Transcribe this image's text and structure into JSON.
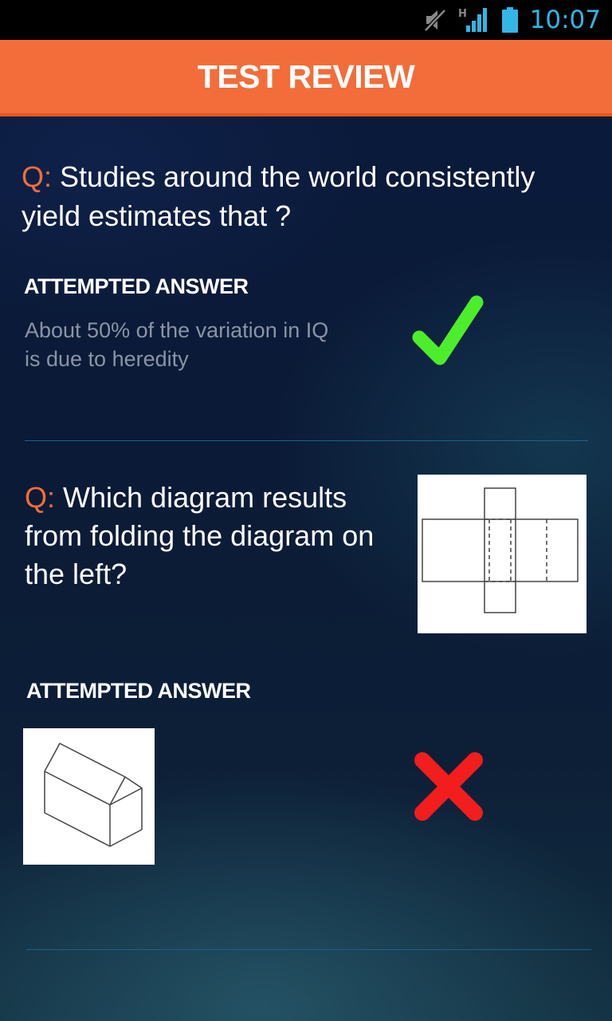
{
  "status_bar": {
    "time": "10:07",
    "network_type": "H",
    "icons": [
      "mute-icon",
      "signal-icon",
      "battery-icon"
    ]
  },
  "app_bar": {
    "title": "TEST REVIEW"
  },
  "questions": [
    {
      "prefix": "Q:",
      "text": "Studies around the world consistently yield estimates that ?",
      "attempted_label": "ATTEMPTED ANSWER",
      "answer_text": "About 50% of the variation in IQ is due to heredity",
      "result": "correct"
    },
    {
      "prefix": "Q:",
      "text": "Which diagram results from folding the diagram on the left?",
      "question_image": "unfolded-net-diagram",
      "attempted_label": "ATTEMPTED ANSWER",
      "answer_image": "folded-house-prism-diagram",
      "result": "incorrect"
    }
  ],
  "colors": {
    "accent": "#f26d3a",
    "correct": "#4ded2c",
    "incorrect": "#f21d1d",
    "divider": "#1f5f8a",
    "clock": "#33b5e5"
  }
}
